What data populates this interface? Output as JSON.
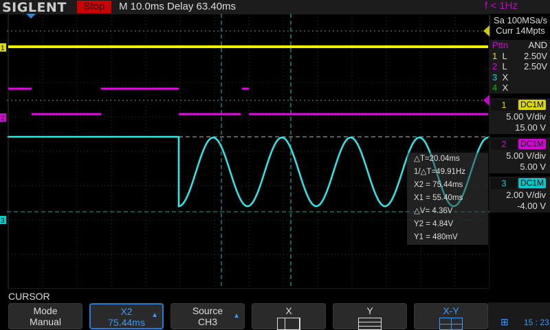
{
  "header": {
    "brand": "SIGLENT",
    "run_state": "Stop",
    "timebase": "M 10.0ms",
    "delay": "Delay 63.40ms",
    "trigger_freq": "f < 1Hz"
  },
  "acquisition": {
    "sample_rate": "Sa 100MSa/s",
    "memory": "Curr 14Mpts"
  },
  "trigger_pattern": {
    "title": "Pttn",
    "logic": "AND",
    "rows": [
      {
        "ch": "1",
        "state": "L",
        "level": "2.50V",
        "color": "#e0e000"
      },
      {
        "ch": "2",
        "state": "L",
        "level": "2.50V",
        "color": "#e000e0"
      },
      {
        "ch": "3",
        "state": "X",
        "level": "",
        "color": "#00d8d8"
      },
      {
        "ch": "4",
        "state": "X",
        "level": "",
        "color": "#00c000"
      }
    ]
  },
  "channels": [
    {
      "num": "1",
      "coupling": "DC1M",
      "scale": "5.00 V/div",
      "offset": "15.00 V",
      "color": "#d8d800"
    },
    {
      "num": "2",
      "coupling": "DC1M",
      "scale": "5.00 V/div",
      "offset": "5.00 V",
      "color": "#d800d8"
    },
    {
      "num": "3",
      "coupling": "DC1M",
      "scale": "2.00 V/div",
      "offset": "-4.00 V",
      "color": "#00c8c8"
    }
  ],
  "cursor_readout": {
    "dT": "△T=20.04ms",
    "inv_dT": "1/△T=49.91Hz",
    "x2": "X2 = 75.44ms",
    "x1": "X1 = 55.40ms",
    "dV": "△V= 4.36V",
    "y2": "Y2 = 4.84V",
    "y1": "Y1 = 480mV"
  },
  "menu": {
    "title": "CURSOR",
    "buttons": [
      {
        "top": "Mode",
        "bottom": "Manual"
      },
      {
        "top": "X2",
        "bottom": "75.44ms"
      },
      {
        "top": "Source",
        "bottom": "CH3"
      },
      {
        "top": "X"
      },
      {
        "top": "Y"
      },
      {
        "top": "X-Y"
      }
    ]
  },
  "status": {
    "time": "15 : 23"
  },
  "markers": {
    "ch1": "1",
    "ch2": "2",
    "ch3": "3"
  }
}
